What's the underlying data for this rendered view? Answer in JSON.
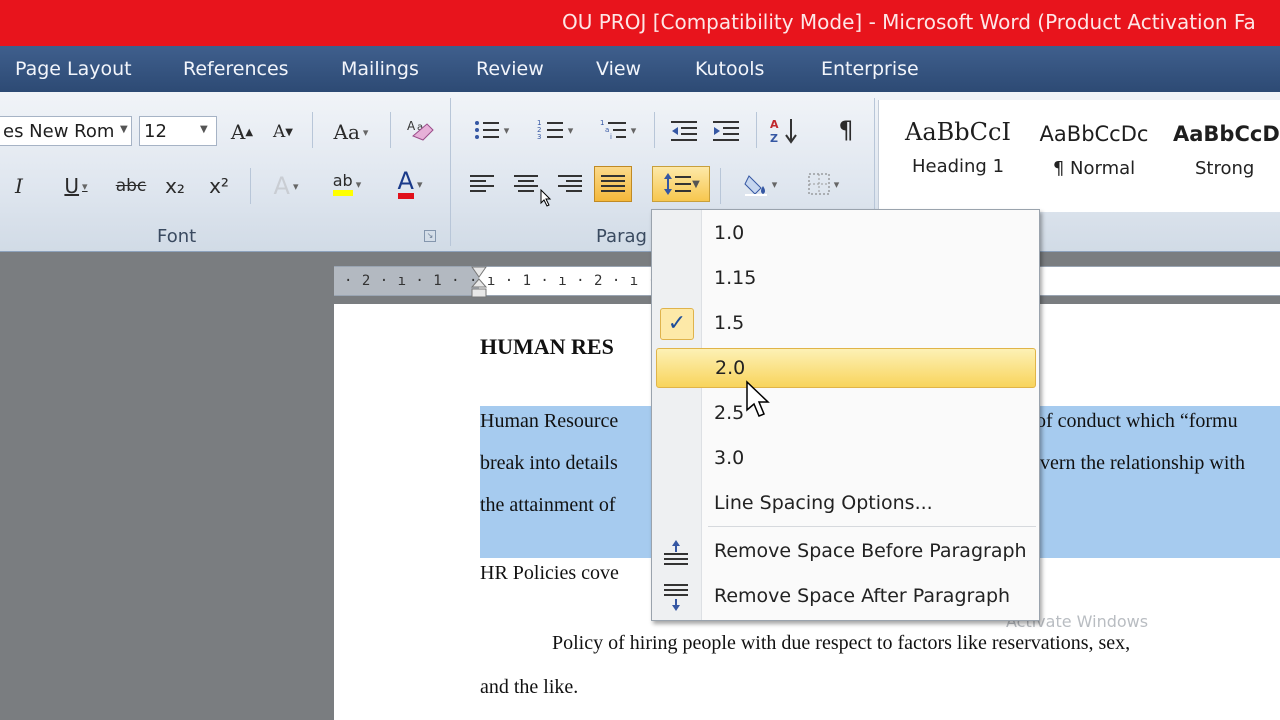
{
  "window": {
    "title": "OU PROJ [Compatibility Mode]  -  Microsoft Word (Product Activation Fa"
  },
  "tabs": [
    "Page Layout",
    "References",
    "Mailings",
    "Review",
    "View",
    "Kutools",
    "Enterprise"
  ],
  "font_group": {
    "font_name": "es New Rom",
    "font_size": "12",
    "grow_font": "A",
    "shrink_font": "A",
    "change_case": "Aa",
    "italic": "I",
    "underline": "U",
    "strikethrough": "abc",
    "subscript": "x₂",
    "superscript": "x²",
    "text_effects": "A",
    "highlight": "ab",
    "font_color": "A",
    "label": "Font"
  },
  "paragraph_group": {
    "label": "Parag",
    "show_marks": "¶"
  },
  "styles": [
    {
      "sample": "AaBbCcI",
      "name": "Heading 1"
    },
    {
      "sample": "AaBbCcDc",
      "name": "¶ Normal"
    },
    {
      "sample": "AaBbCcDc",
      "name": "Strong"
    }
  ],
  "ruler": {
    "ticks": "· 2 · ı · 1 ·    · ı · 1 · ı · 2 · ı · 3                                         10 · ı · 11 · ı · 12 · ı · 13 · ı · 14"
  },
  "document": {
    "heading": "HUMAN RES",
    "line1_left": "Human Resource",
    "line1_right": "of conduct which “formu",
    "line2_left": "break into details",
    "line2_right": "vern the relationship with",
    "line3_left": "the attainment of",
    "line4": "HR Policies cove",
    "line5": "Policy of hiring people with due respect to factors like reservations, sex,",
    "line6": "and the like."
  },
  "line_spacing_menu": {
    "options": [
      "1.0",
      "1.15",
      "1.5",
      "2.0",
      "2.5",
      "3.0"
    ],
    "checked": "1.5",
    "hovered": "2.0",
    "more_options": "Line Spacing Options...",
    "remove_before": "Remove Space Before Paragraph",
    "remove_after": "Remove Space After Paragraph",
    "check_mark": "✓"
  },
  "watermark": "Activate Windows",
  "colors": {
    "title_bar": "#e8141c",
    "tab_bar": "#2d4a74",
    "selection": "#a6cbef",
    "menu_hover": "#f8d45c"
  }
}
